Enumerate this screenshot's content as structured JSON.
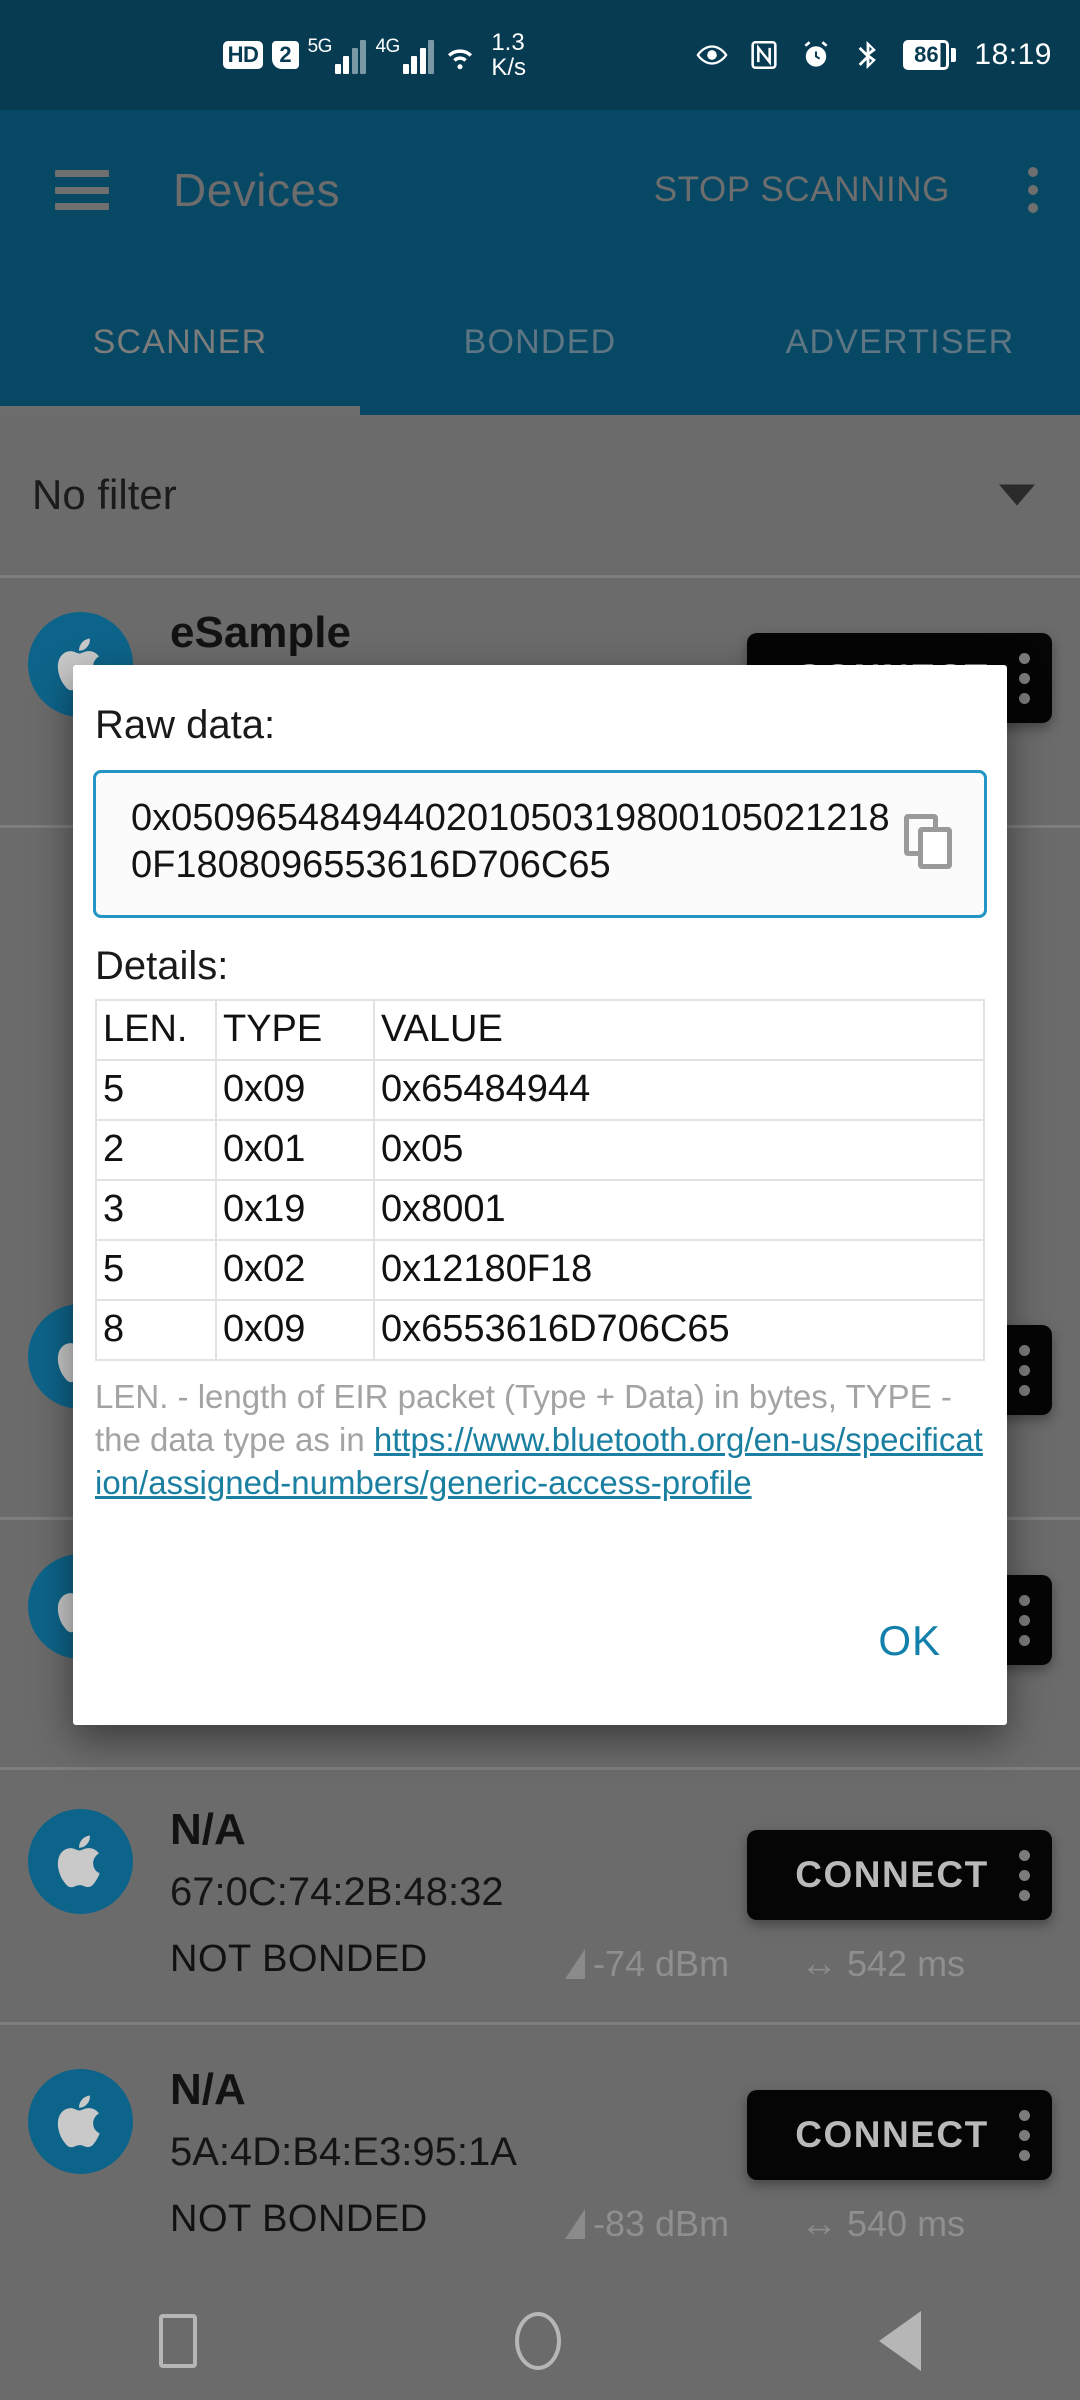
{
  "statusbar": {
    "hd_badge": "HD",
    "sim_badge": "2",
    "net1_label": "5G",
    "net2_label": "4G",
    "netspeed_value": "1.3",
    "netspeed_unit": "K/s",
    "battery_percent": "86",
    "clock": "18:19",
    "icons": [
      "eye-icon",
      "nfc-icon",
      "alarm-icon",
      "bluetooth-icon",
      "battery-icon"
    ],
    "bg_color": "#073b52"
  },
  "appbar": {
    "title": "Devices",
    "action_label": "STOP SCANNING",
    "menu_icon": "kebab-menu-icon",
    "nav_icon": "hamburger-icon",
    "bg_color": "#074965",
    "tabs": [
      {
        "label": "SCANNER",
        "active": true
      },
      {
        "label": "BONDED",
        "active": false
      },
      {
        "label": "ADVERTISER",
        "active": false
      }
    ]
  },
  "filter": {
    "label": "No filter",
    "caret_icon": "chevron-down-icon"
  },
  "devices": [
    {
      "name": "eSample",
      "address": "",
      "bond_state": "",
      "rssi": "",
      "interval": "",
      "connect_label": "CONNECT",
      "avatar_icon": "apple-logo-icon"
    },
    {
      "name": "N/A",
      "address": "67:0C:74:2B:48:32",
      "bond_state": "NOT BONDED",
      "rssi": "-74 dBm",
      "interval": "542 ms",
      "connect_label": "CONNECT",
      "avatar_icon": "apple-logo-icon"
    },
    {
      "name": "N/A",
      "address": "5A:4D:B4:E3:95:1A",
      "bond_state": "NOT BONDED",
      "rssi": "-83 dBm",
      "interval": "540 ms",
      "connect_label": "CONNECT",
      "avatar_icon": "apple-logo-icon"
    }
  ],
  "dialog": {
    "raw_data_label": "Raw data:",
    "raw_data_value": "0x05096548494402010503198001050212180F1808096553616D706C65",
    "copy_icon": "copy-icon",
    "details_label": "Details:",
    "table": {
      "headers": [
        "LEN.",
        "TYPE",
        "VALUE"
      ],
      "rows": [
        [
          "5",
          "0x09",
          "0x65484944"
        ],
        [
          "2",
          "0x01",
          "0x05"
        ],
        [
          "3",
          "0x19",
          "0x8001"
        ],
        [
          "5",
          "0x02",
          "0x12180F18"
        ],
        [
          "8",
          "0x09",
          "0x6553616D706C65"
        ]
      ]
    },
    "footnote_text": "LEN. - length of EIR packet (Type + Data) in bytes, TYPE - the data type as in ",
    "footnote_link": "https://www.bluetooth.org/en-us/specification/assigned-numbers/generic-access-profile",
    "ok_label": "OK",
    "accent_color": "#1181ab",
    "border_color": "#2196c4"
  },
  "navbar": {
    "recents_icon": "square-recents-icon",
    "home_icon": "circle-home-icon",
    "back_icon": "triangle-back-icon"
  }
}
